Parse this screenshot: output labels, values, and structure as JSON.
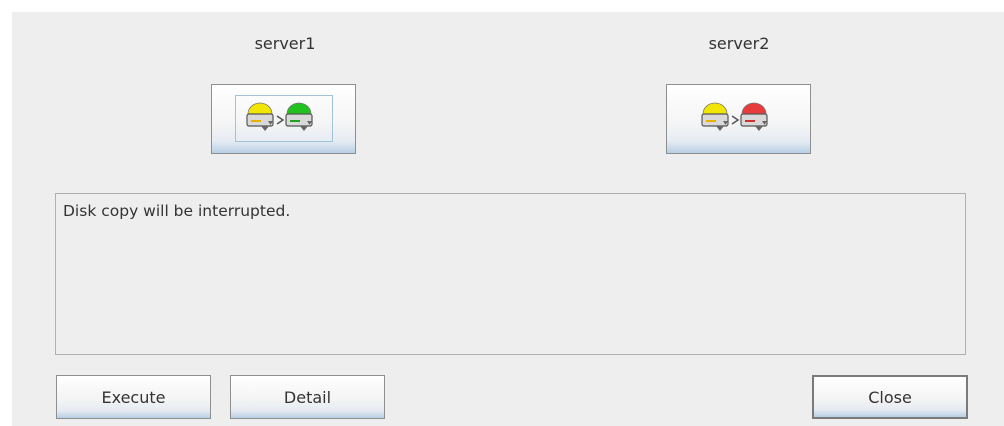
{
  "servers": [
    {
      "name": "server1",
      "source_status_color": "#f2e600",
      "target_status_color": "#22c21e",
      "focused": true
    },
    {
      "name": "server2",
      "source_status_color": "#f2e600",
      "target_status_color": "#e83c3c",
      "focused": false
    }
  ],
  "icons": {
    "server_icon": "disk-server-icon",
    "arrow": "chevron-right-icon",
    "colors": {
      "disk_body": "#d9d9d9",
      "disk_outline": "#555555",
      "led_yellow": "#e8b000",
      "led_green": "#22a21e",
      "led_red": "#d03030"
    }
  },
  "message": {
    "text": "Disk copy will be interrupted."
  },
  "buttons": {
    "execute_label": "Execute",
    "detail_label": "Detail",
    "close_label": "Close"
  }
}
